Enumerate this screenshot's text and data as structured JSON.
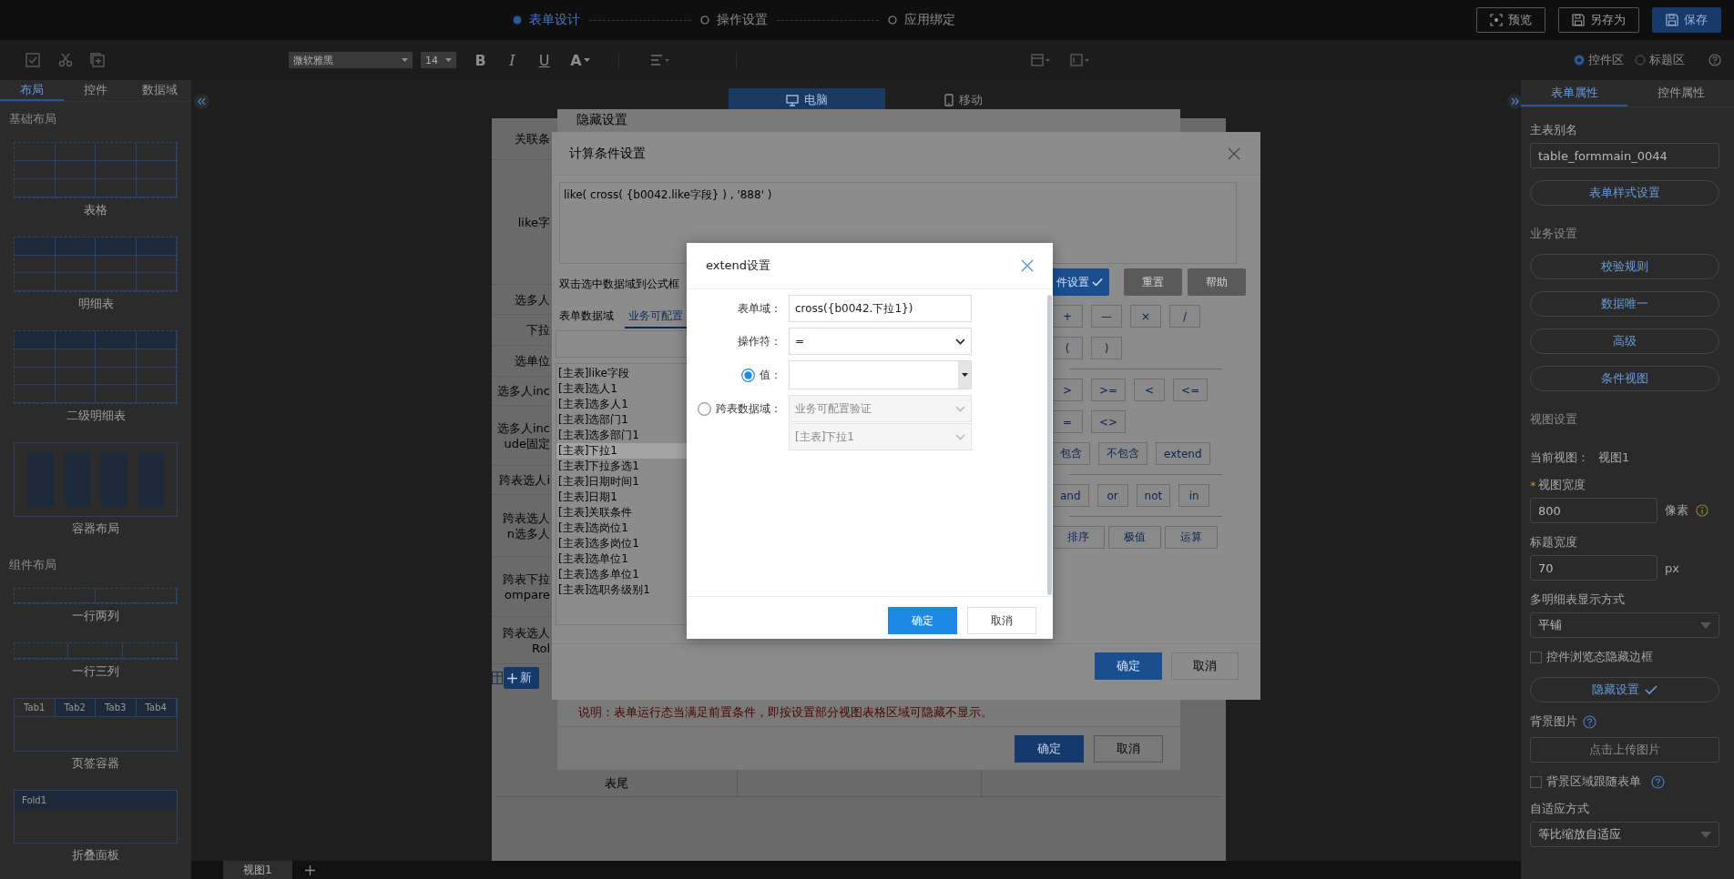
{
  "top_bar": {
    "steps": [
      {
        "label": "表单设计",
        "selected": true
      },
      {
        "label": "操作设置",
        "selected": false
      },
      {
        "label": "应用绑定",
        "selected": false
      }
    ],
    "buttons": [
      {
        "label": "预览",
        "kind": "preview"
      },
      {
        "label": "另存为",
        "kind": "save_as"
      },
      {
        "label": "保存",
        "kind": "save"
      }
    ]
  },
  "toolbar": {
    "font": "微软雅黑",
    "font_size": "14",
    "format_buttons": [
      {
        "label": "B",
        "kind": "bold"
      },
      {
        "label": "I",
        "kind": "italic"
      },
      {
        "label": "U",
        "kind": "underline"
      },
      {
        "label": "A",
        "kind": "color"
      }
    ],
    "areas": [
      {
        "label": "控件区",
        "selected": true
      },
      {
        "label": "标题区",
        "selected": false
      }
    ]
  },
  "left_panel": {
    "tabs": [
      {
        "label": "布局",
        "selected": true
      },
      {
        "label": "控件",
        "selected": false
      },
      {
        "label": "数据域",
        "selected": false
      }
    ],
    "sections": [
      {
        "title": "基础布局",
        "items": [
          {
            "label": "表格",
            "kind": "table"
          },
          {
            "label": "明细表",
            "kind": "detail"
          },
          {
            "label": "二级明细表",
            "kind": "detail2"
          },
          {
            "label": "容器布局",
            "kind": "container"
          }
        ]
      },
      {
        "title": "组件布局",
        "items": [
          {
            "label": "一行两列",
            "kind": "cols2"
          },
          {
            "label": "一行三列",
            "kind": "cols3"
          },
          {
            "label": "页签容器",
            "kind": "tabs",
            "tabs": [
              {
                "label": "Tab1",
                "selected": true
              },
              {
                "label": "Tab2",
                "selected": false
              },
              {
                "label": "Tab3",
                "selected": false
              },
              {
                "label": "Tab4",
                "selected": false
              }
            ]
          },
          {
            "label": "折叠面板",
            "kind": "fold",
            "header": "Fold1"
          }
        ]
      }
    ]
  },
  "canvas": {
    "devices": [
      {
        "label": "电脑",
        "kind": "desktop",
        "selected": true
      },
      {
        "label": "移动",
        "kind": "mobile",
        "selected": false
      }
    ]
  },
  "form_panel": {
    "labels": [
      "关联条",
      "like字",
      "选多人",
      "下拉",
      "选单位",
      "选多人inc",
      "选多人inc\nude固定",
      "跨表选人i",
      "跨表选人\nn选多人",
      "跨表下拉\nompare",
      "跨表选人\nRol"
    ],
    "add_button": "新",
    "footer_label": "表尾"
  },
  "hide_dialog": {
    "title": "隐藏设置",
    "note": "说明：表单运行态当满足前置条件，即按设置部分视图表格区域可隐藏不显示。",
    "buttons": [
      {
        "label": "确定",
        "kind": "primary"
      },
      {
        "label": "取消",
        "kind": "default"
      }
    ]
  },
  "calc_dialog": {
    "title": "计算条件设置",
    "formula": "like( cross( {b0042.like字段} ) , '888' )",
    "hint": "双击选中数据域到公式框",
    "tabs": [
      {
        "label": "表单数据域",
        "selected": false
      },
      {
        "label": "业务可配置",
        "selected": true
      }
    ],
    "fields": [
      {
        "label": "[主表]like字段",
        "selected": false
      },
      {
        "label": "[主表]选人1",
        "selected": false
      },
      {
        "label": "[主表]选多人1",
        "selected": false
      },
      {
        "label": "[主表]选部门1",
        "selected": false
      },
      {
        "label": "[主表]选多部门1",
        "selected": false
      },
      {
        "label": "[主表]下拉1",
        "selected": true
      },
      {
        "label": "[主表]下拉多选1",
        "selected": false
      },
      {
        "label": "[主表]日期时间1",
        "selected": false
      },
      {
        "label": "[主表]日期1",
        "selected": false
      },
      {
        "label": "[主表]关联条件",
        "selected": false
      },
      {
        "label": "[主表]选岗位1",
        "selected": false
      },
      {
        "label": "[主表]选多岗位1",
        "selected": false
      },
      {
        "label": "[主表]选单位1",
        "selected": false
      },
      {
        "label": "[主表]选多单位1",
        "selected": false
      },
      {
        "label": "[主表]选职务级别1",
        "selected": false
      }
    ],
    "actions": [
      {
        "label": "件设置",
        "kind": "primary"
      },
      {
        "label": "重置",
        "kind": "dark"
      },
      {
        "label": "帮助",
        "kind": "dark"
      }
    ],
    "operator_groups": [
      {
        "rows": [
          {
            "buttons": [
              "+",
              "—",
              "×",
              "/"
            ]
          },
          {
            "buttons": [
              "(",
              ")"
            ]
          }
        ]
      },
      {
        "rows": [
          {
            "buttons": [
              ">",
              ">=",
              "<",
              "<="
            ]
          },
          {
            "buttons": [
              "=",
              "<>"
            ]
          },
          {
            "buttons": [
              "包含",
              "不包含",
              "extend"
            ]
          }
        ]
      },
      {
        "rows": [
          {
            "buttons": [
              "and",
              "or",
              "not",
              "in"
            ]
          }
        ]
      },
      {
        "rows": [
          {
            "buttons": [
              "排序",
              "极值",
              "运算"
            ]
          }
        ]
      }
    ],
    "buttons": [
      {
        "label": "确定",
        "kind": "primary"
      },
      {
        "label": "取消",
        "kind": "default"
      }
    ]
  },
  "extend_dialog": {
    "title": "extend设置",
    "form_field": {
      "label": "表单域：",
      "value": "cross({b0042.下拉1})"
    },
    "operator": {
      "label": "操作符：",
      "value": "="
    },
    "sources": [
      {
        "label": "值：",
        "kind": "value",
        "selected": true
      },
      {
        "label": "跨表数据域：",
        "kind": "cross_table",
        "selected": false,
        "options": [
          "业务可配置验证",
          "[主表]下拉1"
        ]
      }
    ],
    "buttons": [
      {
        "label": "确定",
        "kind": "primary"
      },
      {
        "label": "取消",
        "kind": "default"
      }
    ]
  },
  "right_panel": {
    "tabs": [
      {
        "label": "表单属性",
        "selected": true
      },
      {
        "label": "控件属性",
        "selected": false
      }
    ],
    "items": [
      {
        "kind": "label",
        "text": "主表别名"
      },
      {
        "kind": "input",
        "value": "table_formmain_0044"
      },
      {
        "kind": "button",
        "label": "表单样式设置"
      },
      {
        "kind": "heading",
        "text": "业务设置"
      },
      {
        "kind": "button",
        "label": "校验规则"
      },
      {
        "kind": "button",
        "label": "数据唯一"
      },
      {
        "kind": "button",
        "label": "高级"
      },
      {
        "kind": "button",
        "label": "条件视图"
      },
      {
        "kind": "heading",
        "text": "视图设置"
      },
      {
        "kind": "pair",
        "label": "当前视图：",
        "value": "视图1"
      },
      {
        "kind": "label",
        "text": "视图宽度",
        "mark": "*"
      },
      {
        "kind": "input_info",
        "value": "800",
        "unit": "像素"
      },
      {
        "kind": "label",
        "text": "标题宽度"
      },
      {
        "kind": "input",
        "value": "70",
        "unit": "px"
      },
      {
        "kind": "label",
        "text": "多明细表显示方式"
      },
      {
        "kind": "select",
        "value": "平铺"
      },
      {
        "kind": "checkbox",
        "label": "控件浏览态隐藏边框",
        "checked": false
      },
      {
        "kind": "button_check",
        "label": "隐藏设置"
      },
      {
        "kind": "label_help",
        "text": "背景图片"
      },
      {
        "kind": "upload",
        "label": "点击上传图片"
      },
      {
        "kind": "checkbox_help",
        "label": "背景区域跟随表单",
        "checked": false
      },
      {
        "kind": "label",
        "text": "自适应方式"
      },
      {
        "kind": "select",
        "value": "等比缩放自适应"
      }
    ]
  },
  "bottom_bar": {
    "views": [
      {
        "label": "视图1",
        "selected": true
      }
    ]
  }
}
